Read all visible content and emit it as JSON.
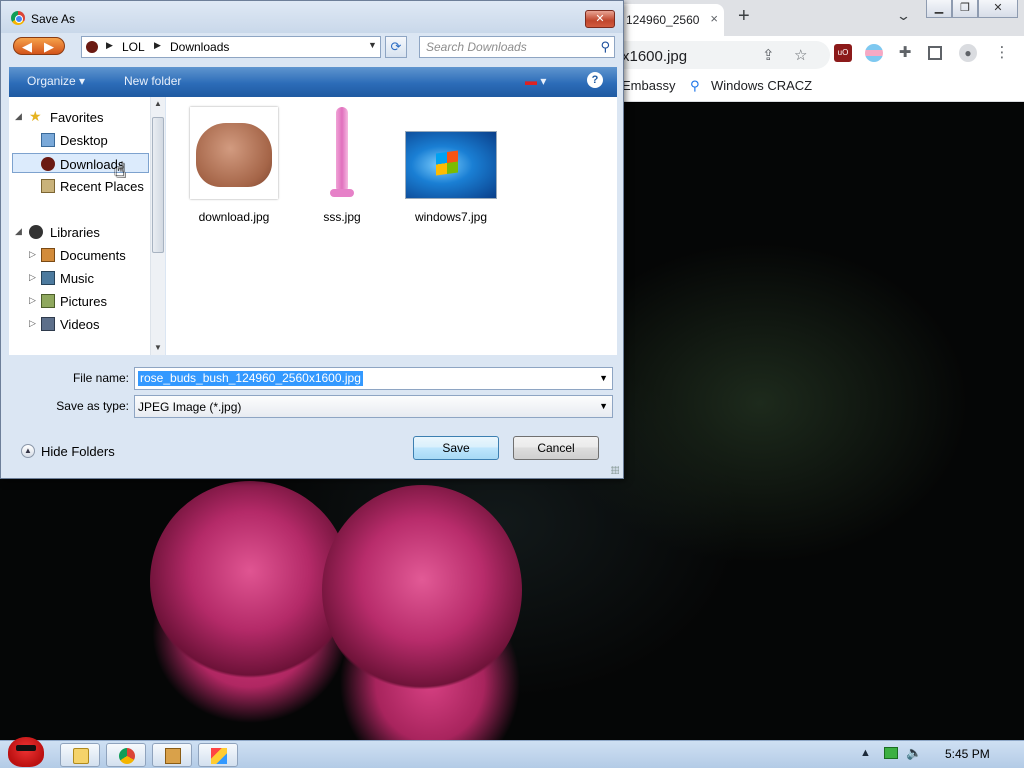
{
  "browser": {
    "tab_title": "124960_2560",
    "tab_close": "×",
    "new_tab": "+",
    "url": "x1600.jpg",
    "bookmarks": [
      "Embassy",
      "Windows CRACZ"
    ]
  },
  "dialog": {
    "title": "Save As",
    "close": "✕",
    "address_crumbs": [
      "LOL",
      "Downloads"
    ],
    "search_placeholder": "Search Downloads",
    "toolbar": {
      "organize": "Organize",
      "new_folder": "New folder",
      "help": "?"
    },
    "nav": {
      "favorites": "Favorites",
      "desktop": "Desktop",
      "downloads": "Downloads",
      "recent_places": "Recent Places",
      "libraries": "Libraries",
      "documents": "Documents",
      "music": "Music",
      "pictures": "Pictures",
      "videos": "Videos"
    },
    "files": [
      {
        "name": "download.jpg"
      },
      {
        "name": "sss.jpg"
      },
      {
        "name": "windows7.jpg"
      }
    ],
    "file_name_label": "File name:",
    "file_name_value": "rose_buds_bush_124960_2560x1600.jpg",
    "save_type_label": "Save as type:",
    "save_type_value": "JPEG Image (*.jpg)",
    "hide_folders": "Hide Folders",
    "save_button": "Save",
    "cancel_button": "Cancel"
  },
  "taskbar": {
    "clock": "5:45 PM"
  },
  "colors": {
    "dialog_bg": "#dbe6f3",
    "command_bar": "#2c6cb8",
    "selection": "#3399ff",
    "rose": "#c2306f"
  }
}
